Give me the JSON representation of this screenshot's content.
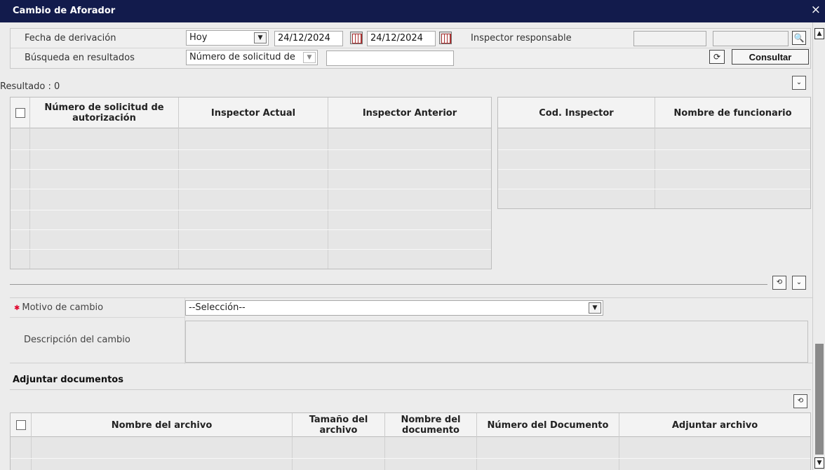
{
  "window": {
    "title": "Cambio de Aforador",
    "close_glyph": "×"
  },
  "search": {
    "fecha_label": "Fecha de derivación",
    "fecha_select": "Hoy",
    "date_from": "24/12/2024",
    "date_to": "24/12/2024",
    "inspector_label": "Inspector responsable",
    "inspector_code": "",
    "inspector_name": "",
    "busqueda_label": "Búsqueda en resultados",
    "busqueda_select": "Número de solicitud de",
    "busqueda_value": "",
    "consultar_label": "Consultar",
    "search_glyph": "🔍",
    "refresh_glyph": "⟳",
    "dd_glyph": "▼"
  },
  "results": {
    "label": "Resultado : 0",
    "toggle_glyph": "⌄",
    "main_table": {
      "headers": [
        "Número de solicitud de autorización",
        "Inspector Actual",
        "Inspector Anterior"
      ],
      "rows": []
    },
    "side_table": {
      "headers": [
        "Cod. Inspector",
        "Nombre de funcionario"
      ],
      "rows": []
    }
  },
  "change": {
    "refresh_glyph": "⟲",
    "toggle_glyph": "⌄",
    "motivo_label": "Motivo de cambio",
    "motivo_value": "--Selección--",
    "descripcion_label": "Descripción del cambio",
    "descripcion_value": ""
  },
  "attachments": {
    "title": "Adjuntar documentos",
    "refresh_glyph": "⟲",
    "headers": [
      "Nombre del archivo",
      "Tamaño del archivo",
      "Nombre del documento",
      "Número del Documento",
      "Adjuntar archivo"
    ],
    "rows": []
  },
  "scrollbar": {
    "up_glyph": "▲",
    "down_glyph": "▼"
  },
  "colors": {
    "titlebar": "#121b4c",
    "required": "#e0002a",
    "panel": "#ececec"
  }
}
